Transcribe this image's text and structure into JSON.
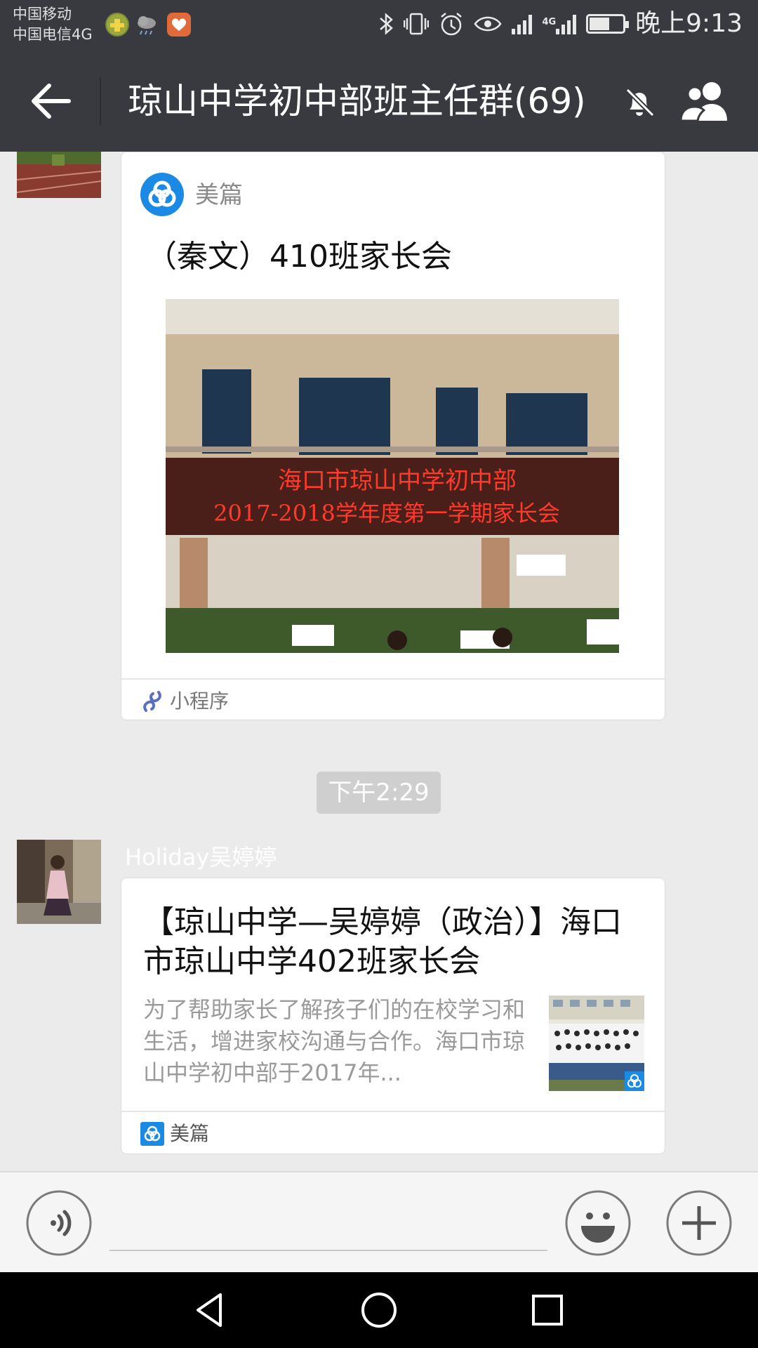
{
  "status_bar": {
    "carrier_1": "中国移动",
    "carrier_2": "中国电信4G",
    "network_label": "4G",
    "time": "晚上9:13",
    "icons": [
      "bluetooth-icon",
      "vibrate-icon",
      "alarm-icon",
      "eye-icon",
      "signal-icon",
      "signal-4g-icon",
      "battery-icon"
    ]
  },
  "header": {
    "title": "琼山中学初中部班主任群(69)",
    "back_icon": "back-arrow-icon",
    "muted_icon": "bell-muted-icon",
    "members_icon": "group-members-icon"
  },
  "messages": [
    {
      "type": "mini_program",
      "app_name": "美篇",
      "title": "（秦文）410班家长会",
      "banner_line1": "海口市琼山中学初中部",
      "banner_line2": "2017-2018学年度第一学期家长会",
      "footer_label": "小程序"
    },
    {
      "type": "timestamp",
      "text": "下午2:29"
    },
    {
      "type": "article",
      "sender": "Holiday吴婷婷",
      "title": "【琼山中学—吴婷婷（政治）】海口市琼山中学402班家长会",
      "description": "为了帮助家长了解孩子们的在校学习和生活，增进家校沟通与合作。海口市琼山中学初中部于2017年...",
      "source": "美篇"
    }
  ],
  "input_bar": {
    "placeholder": "",
    "voice_icon": "voice-icon",
    "emoji_icon": "emoji-icon",
    "plus_icon": "plus-icon"
  },
  "nav_bar": {
    "icons": [
      "nav-back-icon",
      "nav-home-icon",
      "nav-recents-icon"
    ]
  },
  "colors": {
    "header_bg": "#393a3f",
    "chat_bg": "#ebebeb",
    "card_bg": "#ffffff",
    "meipian_blue": "#1a8ae5",
    "time_pill": "#cfcfcf"
  }
}
